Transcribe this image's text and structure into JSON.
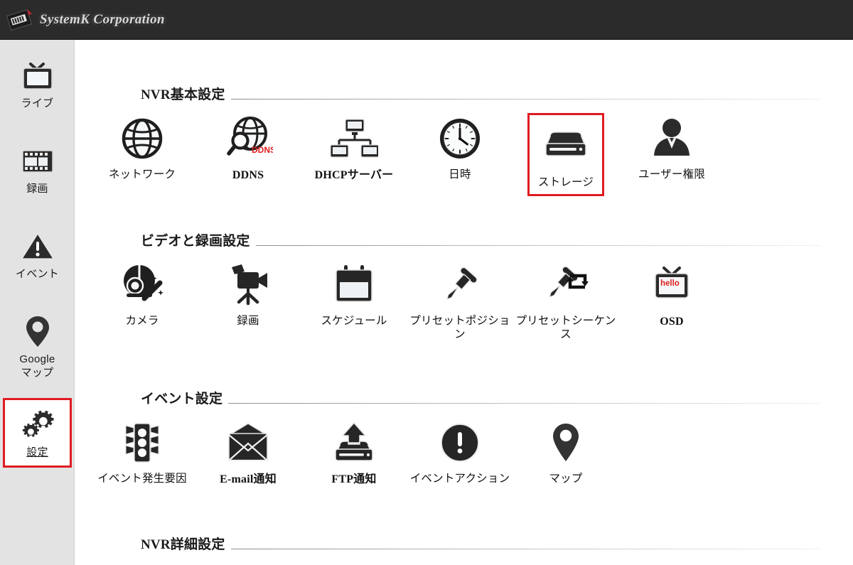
{
  "header": {
    "brand": "SystemK Corporation",
    "logo_icon": "systemk-logo-icon",
    "background_color": "#2b2b2b"
  },
  "accent_colors": {
    "highlight_red": "#e01b22",
    "sidebar_bg": "#e3e3e3",
    "text": "#121212"
  },
  "sidebar": {
    "items": [
      {
        "label": "ライブ",
        "icon": "tv-icon",
        "selected": false
      },
      {
        "label": "録画",
        "icon": "film-strip-icon",
        "selected": false
      },
      {
        "label": "イベント",
        "icon": "warning-triangle-icon",
        "selected": false
      },
      {
        "label": "Google\nマップ",
        "label_line1": "Google",
        "label_line2": "マップ",
        "icon": "map-pin-icon",
        "selected": false
      },
      {
        "label": "設定",
        "icon": "gears-icon",
        "selected": true
      }
    ]
  },
  "sections": [
    {
      "title": "NVR基本設定",
      "items": [
        {
          "label": "ネットワーク",
          "icon": "globe-icon",
          "bold": false,
          "highlighted": false
        },
        {
          "label": "DDNS",
          "icon": "ddns-globe-search-icon",
          "bold": true,
          "highlighted": false
        },
        {
          "label": "DHCPサーバー",
          "icon": "network-servers-icon",
          "bold": true,
          "highlighted": false
        },
        {
          "label": "日時",
          "icon": "clock-icon",
          "bold": false,
          "highlighted": false
        },
        {
          "label": "ストレージ",
          "icon": "storage-drive-icon",
          "bold": false,
          "highlighted": true
        },
        {
          "label": "ユーザー権限",
          "icon": "user-person-icon",
          "bold": false,
          "highlighted": false
        }
      ]
    },
    {
      "title": "ビデオと録画設定",
      "items": [
        {
          "label": "カメラ",
          "icon": "camera-disc-wand-icon",
          "bold": false,
          "highlighted": false
        },
        {
          "label": "録画",
          "icon": "video-camera-icon",
          "bold": false,
          "highlighted": false
        },
        {
          "label": "スケジュール",
          "icon": "calendar-icon",
          "bold": false,
          "highlighted": false
        },
        {
          "label": "プリセットポジション",
          "icon": "pushpin-icon",
          "bold": false,
          "highlighted": false
        },
        {
          "label": "プリセットシーケンス",
          "icon": "pushpin-loop-icon",
          "bold": false,
          "highlighted": false
        },
        {
          "label": "OSD",
          "icon": "tv-hello-icon",
          "bold": true,
          "highlighted": false
        }
      ]
    },
    {
      "title": "イベント設定",
      "items": [
        {
          "label": "イベント発生要因",
          "icon": "traffic-light-icon",
          "bold": false,
          "highlighted": false
        },
        {
          "label": "E-mail通知",
          "icon": "envelope-icon",
          "bold": true,
          "highlighted": false
        },
        {
          "label": "FTP通知",
          "icon": "upload-drive-icon",
          "bold": true,
          "highlighted": false
        },
        {
          "label": "イベントアクション",
          "icon": "exclamation-circle-icon",
          "bold": false,
          "highlighted": false
        },
        {
          "label": "マップ",
          "icon": "map-pin-icon",
          "bold": false,
          "highlighted": false
        }
      ]
    },
    {
      "title": "NVR詳細設定",
      "items": []
    }
  ]
}
